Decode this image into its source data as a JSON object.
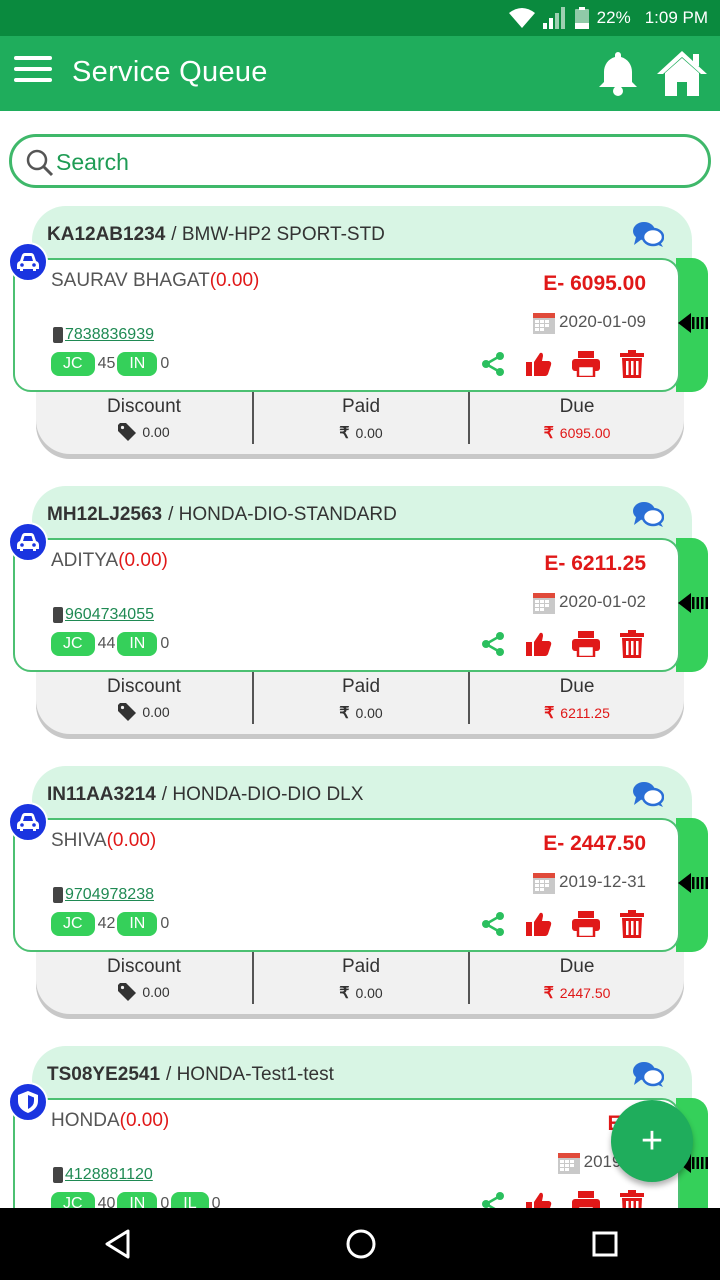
{
  "status_bar": {
    "battery": "22%",
    "time": "1:09 PM"
  },
  "app_bar": {
    "title": "Service Queue"
  },
  "search": {
    "placeholder": "Search"
  },
  "labels": {
    "jc": "JC",
    "in": "IN",
    "il": "IL",
    "discount": "Discount",
    "paid": "Paid",
    "due": "Due"
  },
  "cards": [
    {
      "reg": "KA12AB1234",
      "model": "/ BMW-HP2 SPORT-STD",
      "name": "SAURAV BHAGAT",
      "balance": "(0.00)",
      "estimate": "E- 6095.00",
      "date": "2020-01-09",
      "phone": "7838836939",
      "jc_count": "45",
      "in_count": "0",
      "discount": "0.00",
      "paid": "0.00",
      "due": "6095.00",
      "type_icon": "car-icon"
    },
    {
      "reg": "MH12LJ2563",
      "model": "/ HONDA-DIO-STANDARD",
      "name": "ADITYA",
      "balance": "(0.00)",
      "estimate": "E- 6211.25",
      "date": "2020-01-02",
      "phone": "9604734055",
      "jc_count": "44",
      "in_count": "0",
      "discount": "0.00",
      "paid": "0.00",
      "due": "6211.25",
      "type_icon": "car-icon"
    },
    {
      "reg": "IN11AA3214",
      "model": "/ HONDA-DIO-DIO DLX",
      "name": "SHIVA",
      "balance": "(0.00)",
      "estimate": "E- 2447.50",
      "date": "2019-12-31",
      "phone": "9704978238",
      "jc_count": "42",
      "in_count": "0",
      "discount": "0.00",
      "paid": "0.00",
      "due": "2447.50",
      "type_icon": "car-icon"
    },
    {
      "reg": "TS08YE2541",
      "model": "/ HONDA-Test1-test",
      "name": "HONDA",
      "balance": "(0.00)",
      "estimate": "E- 0",
      "date": "2019-12",
      "phone": "4128881120",
      "jc_count": "40",
      "in_count": "0",
      "il_count": "0",
      "type_icon": "shield-icon"
    }
  ],
  "fab": {
    "label": "+"
  },
  "colors": {
    "primary": "#1fad5c",
    "status_bar": "#0a8a3e",
    "accent_red": "#e01818",
    "pill_green": "#35d05a",
    "badge_blue": "#1a34e0",
    "link_green": "#1f8a53"
  }
}
